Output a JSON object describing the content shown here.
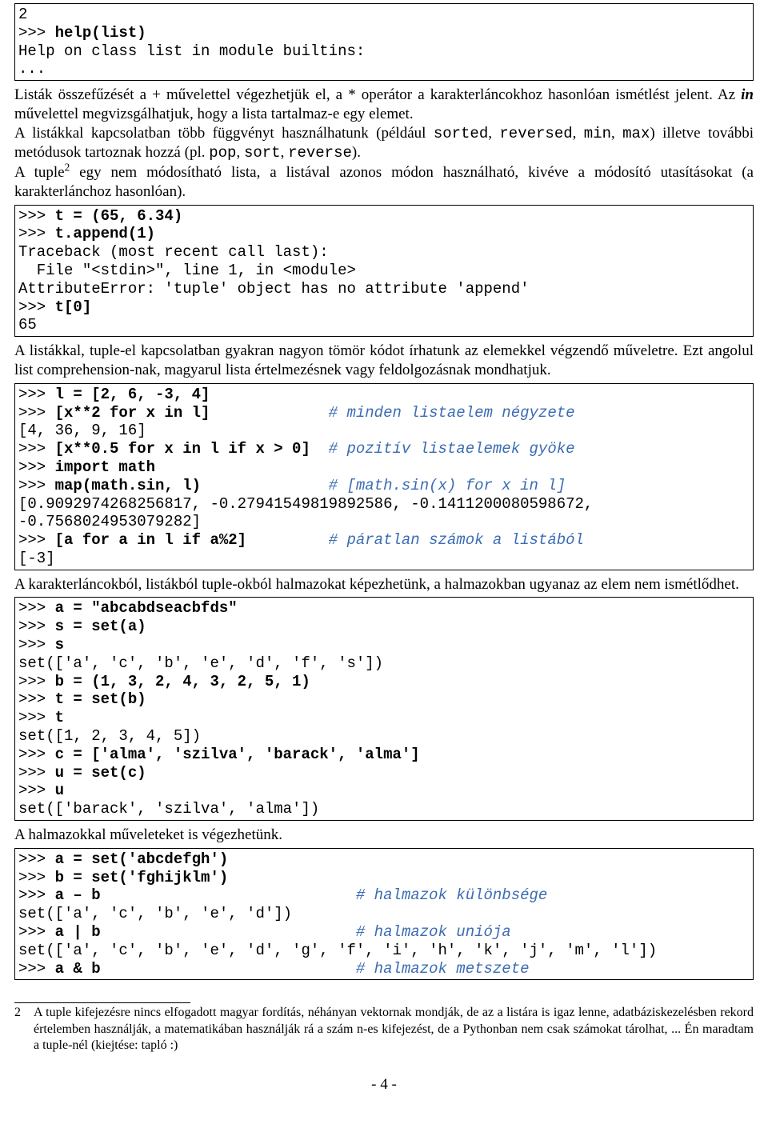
{
  "codebox1": {
    "l1": "2",
    "l2a": ">>> ",
    "l2b": "help(list)",
    "l3": "Help on class list in module builtins:",
    "l4": "..."
  },
  "para1": {
    "t1": "Listák összefűzését a + művelettel végezhetjük el, a * operátor a karakterláncokhoz hasonlóan ismétlést jelent. Az ",
    "t2": "in",
    "t3": " művelettel megvizsgálhatjuk, hogy a lista tartalmaz-e egy elemet.",
    "t4": "A listákkal kapcsolatban több függvényt használhatunk (például ",
    "m1": "sorted",
    "c1": ", ",
    "m2": "reversed",
    "c2": ", ",
    "m3": "min",
    "c3": ", ",
    "m4": "max",
    "t5": ") illetve további metódusok tartoznak hozzá (pl. ",
    "m5": "pop",
    "c4": ", ",
    "m6": "sort",
    "c5": ", ",
    "m7": "reverse",
    "t6": ").",
    "t7": "A tuple",
    "sup": "2",
    "t8": " egy nem módosítható lista, a listával azonos módon használható, kivéve a módosító utasításokat (a karakterlánchoz hasonlóan)."
  },
  "codebox2": {
    "l1a": ">>> ",
    "l1b": "t = (65, 6.34)",
    "l2a": ">>> ",
    "l2b": "t.append(1)",
    "l3": "Traceback (most recent call last):",
    "l4": "  File \"<stdin>\", line 1, in <module>",
    "l5": "AttributeError: 'tuple' object has no attribute 'append'",
    "l6a": ">>> ",
    "l6b": "t[0]",
    "l7": "65"
  },
  "para2": {
    "t1": "A listákkal, tuple-el kapcsolatban gyakran nagyon tömör kódot írhatunk az elemekkel végzendő műveletre. Ezt angolul list comprehension-nak, magyarul lista értelmezésnek vagy feldolgozásnak mondhatjuk."
  },
  "codebox3": {
    "l1a": ">>> ",
    "l1b": "l = [2, 6, -3, 4]",
    "l2a": ">>> ",
    "l2b": "[x**2 for x in l]             ",
    "l2c": "# minden listaelem négyzete",
    "l3": "[4, 36, 9, 16]",
    "l4a": ">>> ",
    "l4b": "[x**0.5 for x in l if x > 0]  ",
    "l4c": "# pozitív listaelemek gyöke",
    "l5a": ">>> ",
    "l5b": "import math",
    "l6a": ">>> ",
    "l6b": "map(math.sin, l)              ",
    "l6c": "# [math.sin(x) for x in l]",
    "l7": "[0.9092974268256817, -0.27941549819892586, -0.1411200080598672,",
    "l8": "-0.7568024953079282]",
    "l9a": ">>> ",
    "l9b": "[a for a in l if a%2]         ",
    "l9c": "# páratlan számok a listából",
    "l10": "[-3]"
  },
  "para3": {
    "t1": "A karakterláncokból, listákból tuple-okból halmazokat képezhetünk, a halmazokban ugyanaz az elem nem ismétlődhet."
  },
  "codebox4": {
    "l1a": ">>> ",
    "l1b": "a = \"abcabdseacbfds\"",
    "l2a": ">>> ",
    "l2b": "s = set(a)",
    "l3a": ">>> ",
    "l3b": "s",
    "l4": "set(['a', 'c', 'b', 'e', 'd', 'f', 's'])",
    "l5a": ">>> ",
    "l5b": "b = (1, 3, 2, 4, 3, 2, 5, 1)",
    "l6a": ">>> ",
    "l6b": "t = set(b)",
    "l7a": ">>> ",
    "l7b": "t",
    "l8": "set([1, 2, 3, 4, 5])",
    "l9a": ">>> ",
    "l9b": "c = ['alma', 'szilva', 'barack', 'alma']",
    "l10a": ">>> ",
    "l10b": "u = set(c)",
    "l11a": ">>> ",
    "l11b": "u",
    "l12": "set(['barack', 'szilva', 'alma'])"
  },
  "para4": {
    "t1": "A halmazokkal műveleteket is végezhetünk."
  },
  "codebox5": {
    "l1a": ">>> ",
    "l1b": "a = set('abcdefgh')",
    "l2a": ">>> ",
    "l2b": "b = set('fghijklm')",
    "l3a": ">>> ",
    "l3b": "a – b                            ",
    "l3c": "# halmazok különbsége",
    "l4": "set(['a', 'c', 'b', 'e', 'd'])",
    "l5a": ">>> ",
    "l5b": "a | b                            ",
    "l5c": "# halmazok uniója",
    "l6": "set(['a', 'c', 'b', 'e', 'd', 'g', 'f', 'i', 'h', 'k', 'j', 'm', 'l'])",
    "l7a": ">>> ",
    "l7b": "a & b                            ",
    "l7c": "# halmazok metszete"
  },
  "footnote": {
    "num": "2",
    "text": "A tuple kifejezésre nincs elfogadott magyar fordítás, néhányan vektornak mondják, de az a listára is igaz lenne, adatbáziskezelésben rekord értelemben használják, a matematikában használják rá a szám n-es kifejezést, de a Pythonban nem csak számokat tárolhat, ... Én maradtam a tuple-nél (kiejtése: tapló :)"
  },
  "pagenum": "- 4 -"
}
